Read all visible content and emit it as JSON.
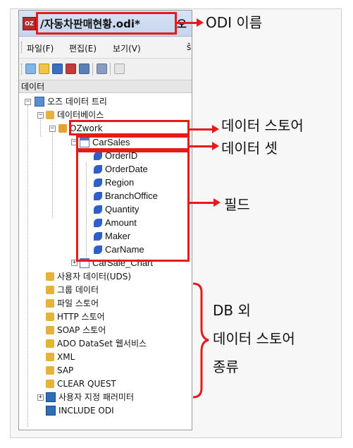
{
  "window": {
    "title": "/자동차판매현황.odi*",
    "title_suffix": "오",
    "app_icon_text": "OZ"
  },
  "menu": {
    "items": [
      "파일(F)",
      "편집(E)",
      "보기(V)",
      "ŝ"
    ]
  },
  "panel": {
    "title": "데이터"
  },
  "tree": {
    "root": "오즈 데이터 트리",
    "database": "데이터베이스",
    "store": "OZwork",
    "dataset": "CarSales",
    "fields": [
      "OrderID",
      "OrderDate",
      "Region",
      "BranchOffice",
      "Quantity",
      "Amount",
      "Maker",
      "CarName"
    ],
    "dataset2": "CarSale_Chart",
    "others": [
      "사용자 데이터(UDS)",
      "그룹 데이터",
      "파일 스토어",
      "HTTP 스토어",
      "SOAP 스토어",
      "ADO DataSet 웹서비스",
      "XML",
      "SAP",
      "CLEAR QUEST"
    ],
    "params": "사용자 지정 패러미터",
    "include": "INCLUDE ODI"
  },
  "callouts": {
    "odi_name": "ODI 이름",
    "data_store": "데이터 스토어",
    "data_set": "데이터 셋",
    "field": "필드",
    "other_stores": [
      "DB 외",
      "데이터 스토어",
      "종류"
    ]
  },
  "colors": {
    "annotation_red": "#e31b1b",
    "title_bar": "#c6d5ee"
  }
}
